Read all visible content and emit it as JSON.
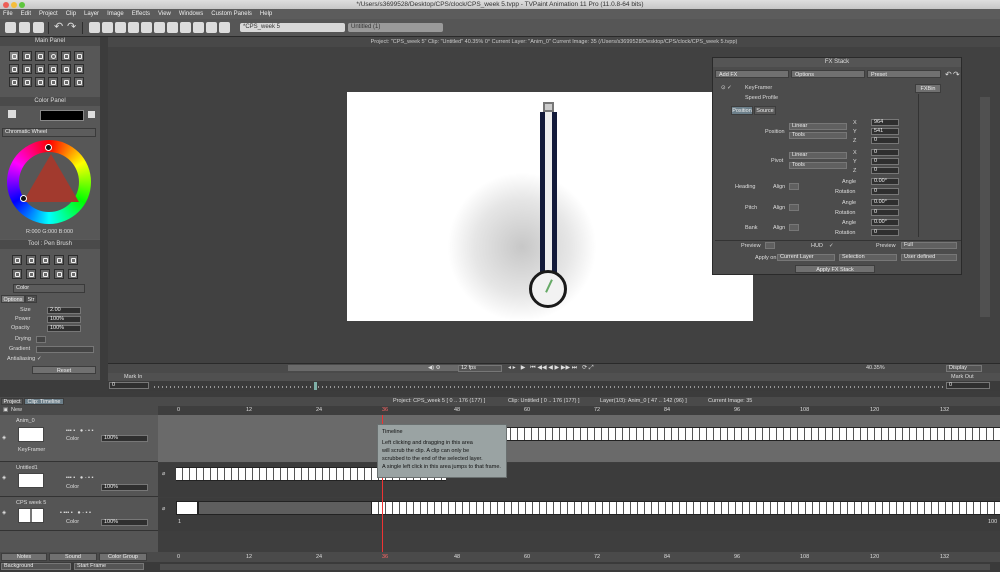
{
  "window": {
    "title": "*/Users/s3699528/Desktop/CPS/clock/CPS_week 5.tvpp - TVPaint Animation 11 Pro (11.0.8-64 bits)"
  },
  "menu": [
    "File",
    "Edit",
    "Project",
    "Clip",
    "Layer",
    "Image",
    "Effects",
    "View",
    "Windows",
    "Custom Panels",
    "Help"
  ],
  "tabs": [
    {
      "label": "*CPS_week 5"
    },
    {
      "label": "Untitled (1)"
    }
  ],
  "main_panel": {
    "title": "Main Panel"
  },
  "color_panel": {
    "title": "Color Panel",
    "mode": "Chromatic Wheel",
    "rgb": "R:000 G:000 B:000"
  },
  "tool_panel": {
    "title": "Tool : Pen Brush",
    "mode": "Color",
    "tab_options": "Options",
    "tab_stroke": "Str",
    "rows": [
      {
        "label": "Size",
        "value": "2.00"
      },
      {
        "label": "Power",
        "value": "100%"
      },
      {
        "label": "Opacity",
        "value": "100%"
      },
      {
        "label": "Drying",
        "value": ""
      },
      {
        "label": "Gradient",
        "value": ""
      },
      {
        "label": "Antialiasing",
        "value": "✓"
      }
    ],
    "reset": "Reset"
  },
  "project_info": "Project: \"CPS_week 5\"  Clip: \"Untitled\"  40.35%  0°  Current Layer: \"Anim_0\"  Current Image: 35 (/Users/s3699528/Desktop/CPS/clock/CPS_week 5.tvpp)",
  "fx": {
    "title": "FX Stack",
    "add_fx": "Add FX",
    "options": "Options",
    "preset": "Preset",
    "keyframer": "KeyFramer",
    "speed": "Speed Profile",
    "fxbin": "FXBin",
    "tab_position": "Position",
    "tab_source": "Source",
    "position": "Position",
    "pivot": "Pivot",
    "heading": "Heading",
    "pitch": "Pitch",
    "bank": "Bank",
    "align": "Align",
    "linear": "Linear",
    "tools": "Tools",
    "angle": "Angle",
    "rotation": "Rotation",
    "pos_x": "964",
    "pos_y": "541",
    "pos_z": "0",
    "piv_x": "0",
    "piv_y": "0",
    "piv_z": "0",
    "angle_val": "0.00°",
    "rot_val": "0",
    "preview": "Preview",
    "hud": "HUD",
    "preview2": "Preview",
    "full": "Full",
    "apply_on": "Apply on",
    "current_layer": "Current Layer",
    "selection": "Selection",
    "user_defined": "User defined",
    "apply": "Apply FX Stack"
  },
  "viewport": {
    "fps": "12 fps",
    "zoom": "40.35%",
    "display": "Display",
    "mark_in": "Mark In",
    "mark_out": "Mark Out",
    "in_val": "0",
    "out_val": "0"
  },
  "timeline": {
    "tab_project": "Project",
    "tab_clip": "Clip: Timeline",
    "info_project": "Project: CPS_week 5 [ 0 .. 176 (177) ]",
    "info_clip": "Clip: Untitled [ 0 .. 176 (177) ]",
    "info_layer": "Layer(1/3): Anim_0 [ 47 .. 142 (96) ]",
    "info_image": "Current Image: 35",
    "new": "New",
    "ticks": [
      "0",
      "12",
      "24",
      "36",
      "48",
      "60",
      "72",
      "84",
      "96",
      "108",
      "120",
      "132"
    ],
    "layers": [
      {
        "name": "Anim_0",
        "sub": "KeyFramer",
        "color": "Color",
        "opacity": "100%"
      },
      {
        "name": "Untitled1",
        "color": "Color",
        "opacity": "100%"
      },
      {
        "name": "CPS week 5",
        "color": "Color",
        "opacity": "100%"
      }
    ],
    "marker": "36",
    "start_num": "1",
    "end_num": "100",
    "tooltip": {
      "title": "Timeline",
      "l1": "Left clicking and dragging in this area",
      "l2": "will scrub the clip. A clip can only be",
      "l3": "scrubbed to the end of the selected layer.",
      "l4": "A single left click in this area jumps to that frame."
    }
  },
  "bottom": {
    "notes": "Notes",
    "sound": "Sound",
    "color_group": "Color Group",
    "background": "Background",
    "start_frame": "Start Frame"
  }
}
